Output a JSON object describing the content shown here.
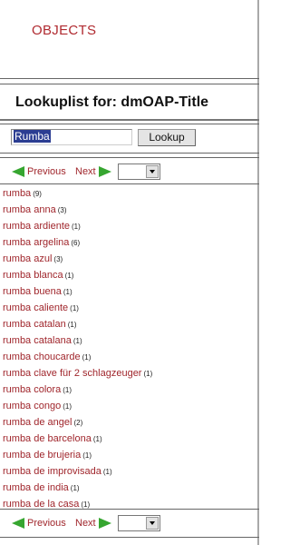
{
  "header": {
    "title": "OBJECTS"
  },
  "lookup": {
    "title": "Lookuplist for: dmOAP-Title"
  },
  "search": {
    "value": "Rumba",
    "button_label": "Lookup"
  },
  "pager": {
    "previous_label": "Previous",
    "next_label": "Next"
  },
  "results": [
    {
      "label": "rumba",
      "count": "(9)"
    },
    {
      "label": "rumba anna",
      "count": "(3)"
    },
    {
      "label": "rumba ardiente",
      "count": "(1)"
    },
    {
      "label": "rumba argelina",
      "count": "(6)"
    },
    {
      "label": "rumba azul",
      "count": "(3)"
    },
    {
      "label": "rumba blanca",
      "count": "(1)"
    },
    {
      "label": "rumba buena",
      "count": "(1)"
    },
    {
      "label": "rumba caliente",
      "count": "(1)"
    },
    {
      "label": "rumba catalan",
      "count": "(1)"
    },
    {
      "label": "rumba catalana",
      "count": "(1)"
    },
    {
      "label": "rumba choucarde",
      "count": "(1)"
    },
    {
      "label": "rumba clave für 2 schlagzeuger",
      "count": "(1)"
    },
    {
      "label": "rumba colora",
      "count": "(1)"
    },
    {
      "label": "rumba congo",
      "count": "(1)"
    },
    {
      "label": "rumba de angel",
      "count": "(2)"
    },
    {
      "label": "rumba de barcelona",
      "count": "(1)"
    },
    {
      "label": "rumba de brujeria",
      "count": "(1)"
    },
    {
      "label": "rumba de improvisada",
      "count": "(1)"
    },
    {
      "label": "rumba de india",
      "count": "(1)"
    },
    {
      "label": "rumba de la casa",
      "count": "(1)"
    }
  ]
}
